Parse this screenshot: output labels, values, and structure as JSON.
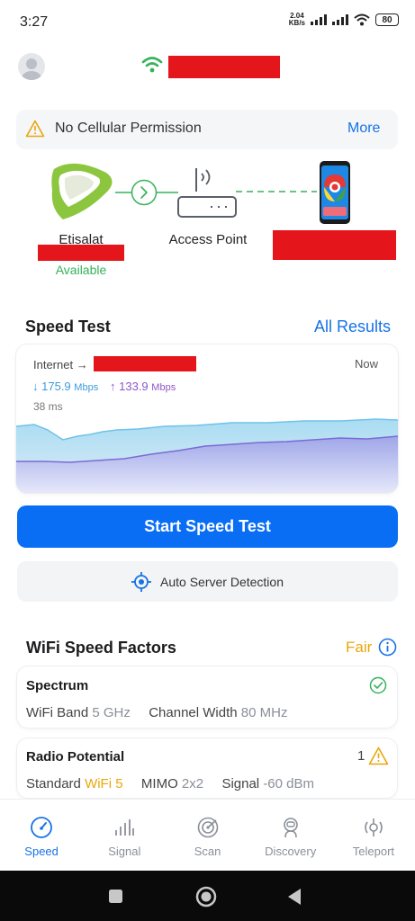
{
  "status_bar": {
    "time": "3:27",
    "net_speed_value": "2.04",
    "net_speed_unit": "KB/s",
    "battery": "80"
  },
  "permission": {
    "text": "No Cellular Permission",
    "more": "More"
  },
  "topology": {
    "provider": "Etisalat",
    "provider_status": "Available",
    "access_point": "Access Point"
  },
  "speed_test": {
    "title": "Speed Test",
    "all_results": "All Results",
    "route_prefix": "Internet →",
    "time_label": "Now",
    "down_arrow": "↓",
    "download": "175.9",
    "up_arrow": "↑",
    "upload": "133.9",
    "unit": "Mbps",
    "latency": "38 ms",
    "start_button": "Start Speed Test",
    "auto_server": "Auto Server Detection"
  },
  "factors": {
    "title": "WiFi Speed Factors",
    "rating": "Fair",
    "spectrum": {
      "title": "Spectrum",
      "band_label": "WiFi Band",
      "band_value": "5 GHz",
      "width_label": "Channel Width",
      "width_value": "80 MHz"
    },
    "radio": {
      "title": "Radio Potential",
      "warning_count": "1",
      "standard_label": "Standard",
      "standard_value": "WiFi 5",
      "mimo_label": "MIMO",
      "mimo_value": "2x2",
      "signal_label": "Signal",
      "signal_value": "-60 dBm"
    }
  },
  "nav": {
    "items": [
      {
        "label": "Speed",
        "active": true
      },
      {
        "label": "Signal"
      },
      {
        "label": "Scan"
      },
      {
        "label": "Discovery"
      },
      {
        "label": "Teleport"
      }
    ]
  },
  "colors": {
    "accent": "#0a6ef5",
    "link": "#1673e6",
    "available": "#35b25b",
    "warning": "#e8a70b",
    "download": "#3a9bdc",
    "upload": "#8e56c8"
  }
}
